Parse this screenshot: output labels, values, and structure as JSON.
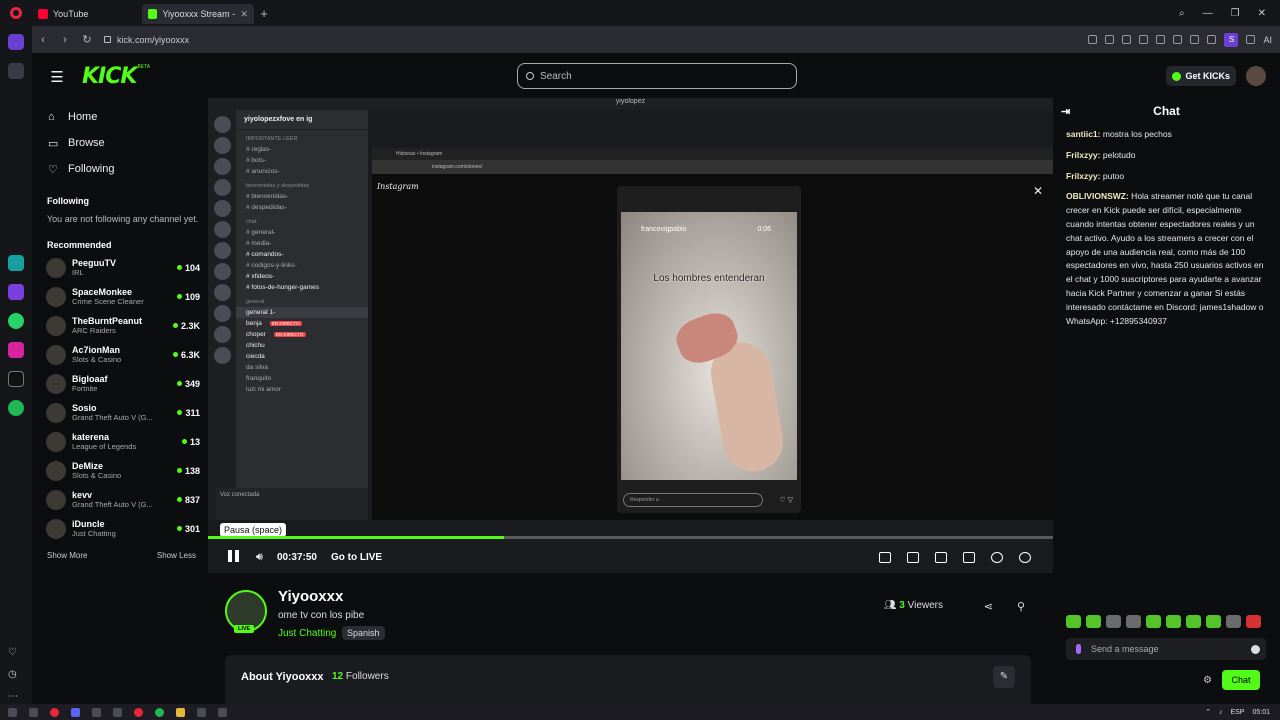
{
  "browser": {
    "tabs": [
      {
        "label": "YouTube"
      },
      {
        "label": "Yiyooxxx Stream - W"
      }
    ],
    "url": "kick.com/yiyooxxx",
    "extension_ai": "AI"
  },
  "header": {
    "logo": "KICK",
    "logo_badge": "BETA",
    "search_placeholder": "Search",
    "get_kicks": "Get KICKs"
  },
  "sidebar": {
    "nav": [
      {
        "label": "Home",
        "icon": "home-icon"
      },
      {
        "label": "Browse",
        "icon": "browse-icon"
      },
      {
        "label": "Following",
        "icon": "heart-icon"
      }
    ],
    "following_title": "Following",
    "following_empty": "You are not following any channel yet.",
    "recommended_title": "Recommended",
    "channels": [
      {
        "name": "PeeguuTV",
        "category": "IRL",
        "viewers": "104"
      },
      {
        "name": "SpaceMonkee",
        "category": "Crime Scene Cleaner",
        "viewers": "109"
      },
      {
        "name": "TheBurntPeanut",
        "category": "ARC Raiders",
        "viewers": "2.3K"
      },
      {
        "name": "Ac7ionMan",
        "category": "Slots & Casino",
        "viewers": "6.3K"
      },
      {
        "name": "Bigloaaf",
        "category": "Fortnite",
        "viewers": "349"
      },
      {
        "name": "Sosio",
        "category": "Grand Theft Auto V (G...",
        "viewers": "311"
      },
      {
        "name": "katerena",
        "category": "League of Legends",
        "viewers": "13"
      },
      {
        "name": "DeMize",
        "category": "Slots & Casino",
        "viewers": "138"
      },
      {
        "name": "kevv",
        "category": "Grand Theft Auto V (G...",
        "viewers": "837"
      },
      {
        "name": "iDuncle",
        "category": "Just Chatting",
        "viewers": "301"
      }
    ],
    "show_more": "Show More",
    "show_less": "Show Less"
  },
  "video": {
    "discord_window_title": "yiyolopez",
    "discord_server": "yiyolopezxfove en ig",
    "discord_channels": [
      {
        "label": "IMPORTANTE LEER",
        "type": "cat"
      },
      {
        "label": "# reglas-",
        "type": "ch"
      },
      {
        "label": "# bots-",
        "type": "ch"
      },
      {
        "label": "# anuncios-",
        "type": "ch"
      },
      {
        "label": "bienvenidas y despedidas",
        "type": "cat"
      },
      {
        "label": "# bienvenidas-",
        "type": "ch"
      },
      {
        "label": "# despedidas-",
        "type": "ch"
      },
      {
        "label": "chat",
        "type": "cat"
      },
      {
        "label": "# general-",
        "type": "ch"
      },
      {
        "label": "# media-",
        "type": "ch"
      },
      {
        "label": "# comandos-",
        "type": "bright"
      },
      {
        "label": "# codigos-y-links-",
        "type": "ch"
      },
      {
        "label": "# xfideos-",
        "type": "bright"
      },
      {
        "label": "# fotos-de-hunger-games",
        "type": "bright"
      },
      {
        "label": "general",
        "type": "cat"
      },
      {
        "label": "general 1-",
        "type": "sel"
      },
      {
        "label": "benja",
        "type": "live"
      },
      {
        "label": "choper",
        "type": "live"
      },
      {
        "label": "chichu",
        "type": "bright"
      },
      {
        "label": "ciecda",
        "type": "bright"
      },
      {
        "label": "da silva",
        "type": "ch"
      },
      {
        "label": "franquito",
        "type": "ch"
      },
      {
        "label": "luzi mi amor",
        "type": "ch"
      }
    ],
    "live_tag": "EN DIRECTO",
    "voice_status": "Voz conectada",
    "insta_tab": "Historias • Instagram",
    "insta_url": "instagram.com/stories/",
    "insta_logo": "Instagram",
    "story_user": "francovigpablo",
    "story_time": "0:06",
    "story_caption": "Los hombres entenderan",
    "story_reply": "Responder a",
    "tooltip": "Pausa (space)",
    "time": "00:37:50",
    "go_live": "Go to LIVE",
    "progress": 0.35
  },
  "stream": {
    "name": "Yiyooxxx",
    "title": "ome tv con los pibe",
    "category": "Just Chatting",
    "language": "Spanish",
    "live": "LIVE",
    "viewers_count": "3",
    "viewers_label": "Viewers",
    "about_title": "About Yiyooxxx",
    "followers_count": "12",
    "followers_label": "Followers"
  },
  "chat": {
    "title": "Chat",
    "messages": [
      {
        "user": "santiic1:",
        "text": " mostra los pechos"
      },
      {
        "user": "Frilxzyy:",
        "text": " pelotudo"
      },
      {
        "user": "Frilxzyy:",
        "text": " putoo"
      },
      {
        "user": "OBLIVIONSWZ:",
        "text": " Hola streamer noté que tu canal crecer en Kick puede ser difícil, especialmente cuando intentas obtener espectadores reales y un chat activo. Ayudo a los streamers a crecer con el apoyo de una audiencia real, como más de 100 espectadores en vivo, hasta 250 usuarios activos en el chat y 1000 suscriptores para ayudarte a avanzar hacia Kick Partner y comenzar a ganar Si estás interesado contáctame en Discord: james1shadow o WhatsApp: +12895340937"
      }
    ],
    "input_placeholder": "Send a message",
    "send_label": "Chat"
  },
  "taskbar": {
    "lang": "ESP",
    "clock": "05:01"
  },
  "colors": {
    "accent": "#53fc18",
    "background": "#0b0d0e",
    "chat_username": "#f0e8c0"
  }
}
